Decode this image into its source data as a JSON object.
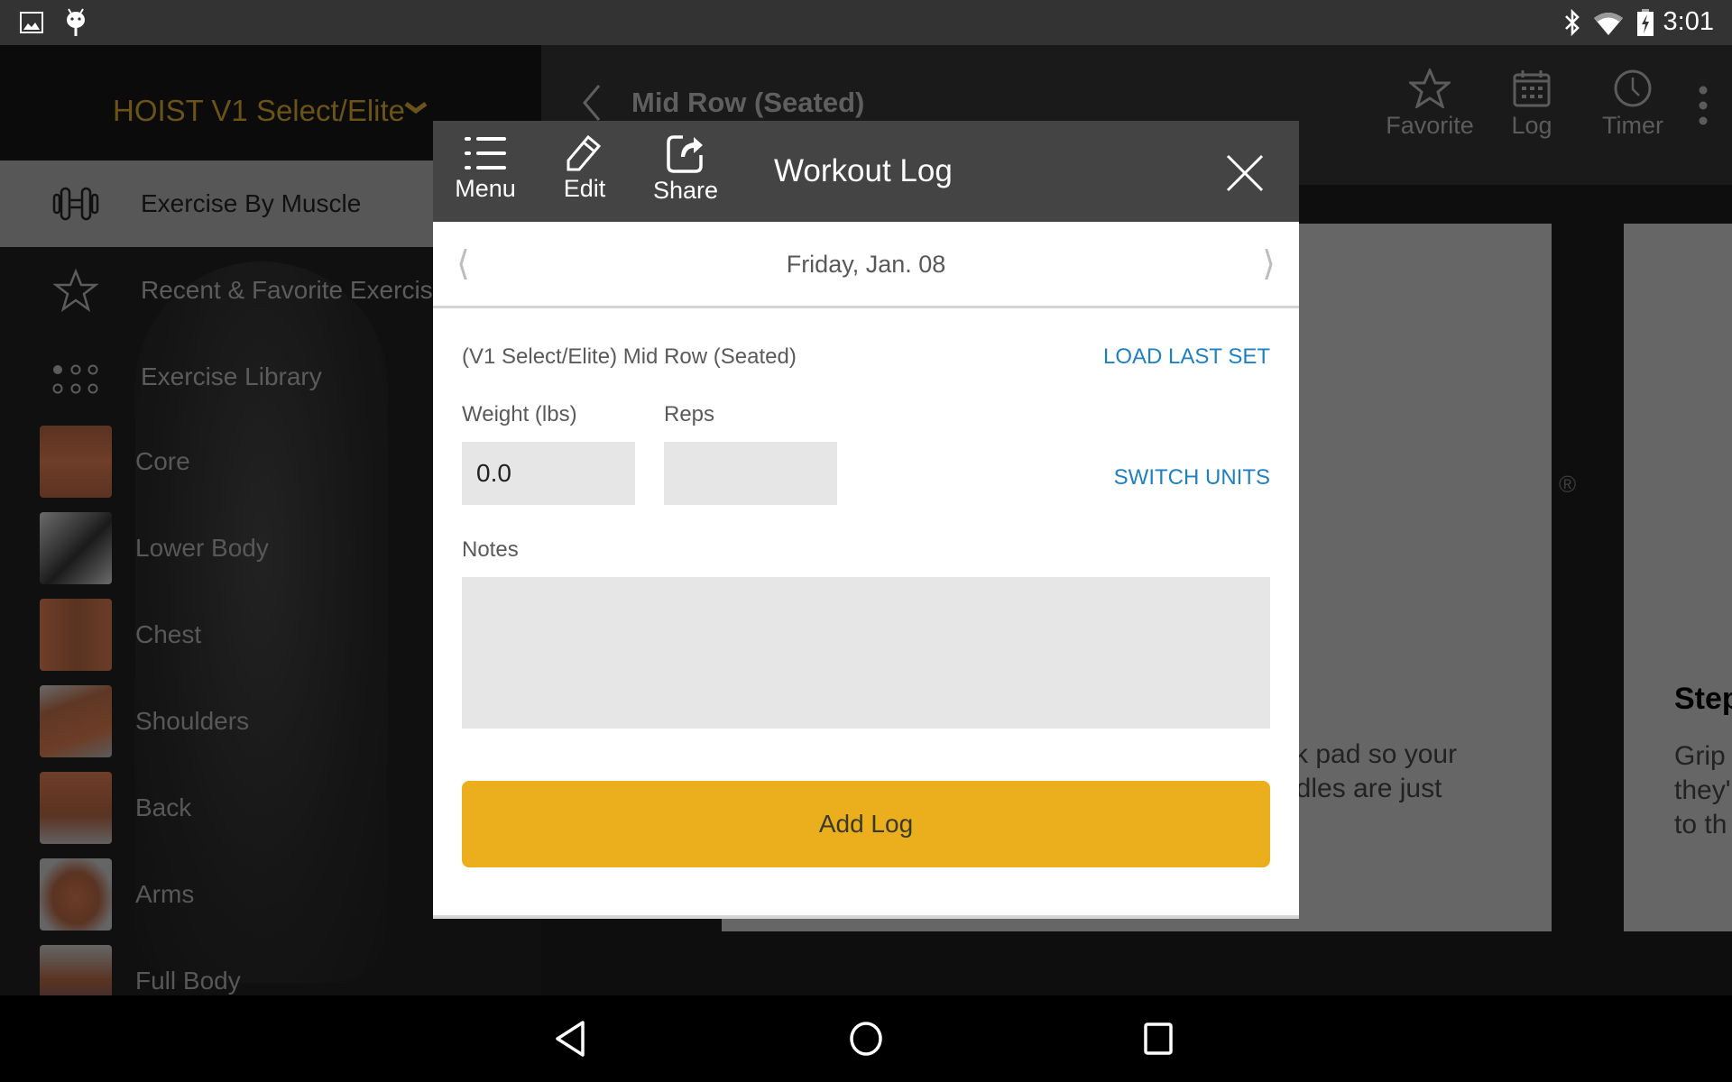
{
  "status_bar": {
    "time": "3:01",
    "left_icons": [
      "gallery-icon",
      "android-debug-icon"
    ],
    "right_icons": [
      "bluetooth-icon",
      "wifi-icon",
      "battery-charging-icon"
    ]
  },
  "sidebar": {
    "brand_title": "HOIST V1 Select/Elite",
    "brand_color": "#6b5318",
    "nav_items": [
      {
        "label": "Exercise By Muscle",
        "icon": "dumbbell-icon",
        "active": true
      },
      {
        "label": "Recent & Favorite Exercises",
        "icon": "star-icon",
        "active": false
      },
      {
        "label": "Exercise Library",
        "icon": "dots-grid-icon",
        "active": false
      }
    ],
    "muscle_groups": [
      {
        "label": "Core"
      },
      {
        "label": "Lower Body"
      },
      {
        "label": "Chest"
      },
      {
        "label": "Shoulders"
      },
      {
        "label": "Back"
      },
      {
        "label": "Arms"
      },
      {
        "label": "Full Body"
      }
    ]
  },
  "main": {
    "title": "Mid Row (Seated)",
    "actions": [
      {
        "label": "Favorite",
        "icon": "star-icon"
      },
      {
        "label": "Log",
        "icon": "calendar-icon"
      },
      {
        "label": "Timer",
        "icon": "clock-icon"
      }
    ],
    "card_text": [
      "ck pad so your",
      "ndles are just"
    ],
    "card2_title": "Step",
    "card2_text": [
      "Grip",
      "they'",
      "to th"
    ],
    "registered_mark": "®"
  },
  "dialog": {
    "title": "Workout Log",
    "toolbar": {
      "menu_label": "Menu",
      "edit_label": "Edit",
      "share_label": "Share"
    },
    "date": "Friday, Jan. 08",
    "prev_glyph": "⟨",
    "next_glyph": "⟩",
    "exercise_name": "(V1 Select/Elite) Mid Row (Seated)",
    "load_last_set_label": "LOAD LAST SET",
    "switch_units_label": "SWITCH UNITS",
    "weight_label": "Weight (lbs)",
    "weight_value": "0.0",
    "reps_label": "Reps",
    "reps_value": "",
    "notes_label": "Notes",
    "notes_value": "",
    "add_log_label": "Add Log",
    "accent_color": "#ebae1d",
    "link_color": "#1f80c2"
  },
  "nav_bar": {
    "buttons": [
      "back-icon",
      "home-icon",
      "recents-icon"
    ]
  }
}
